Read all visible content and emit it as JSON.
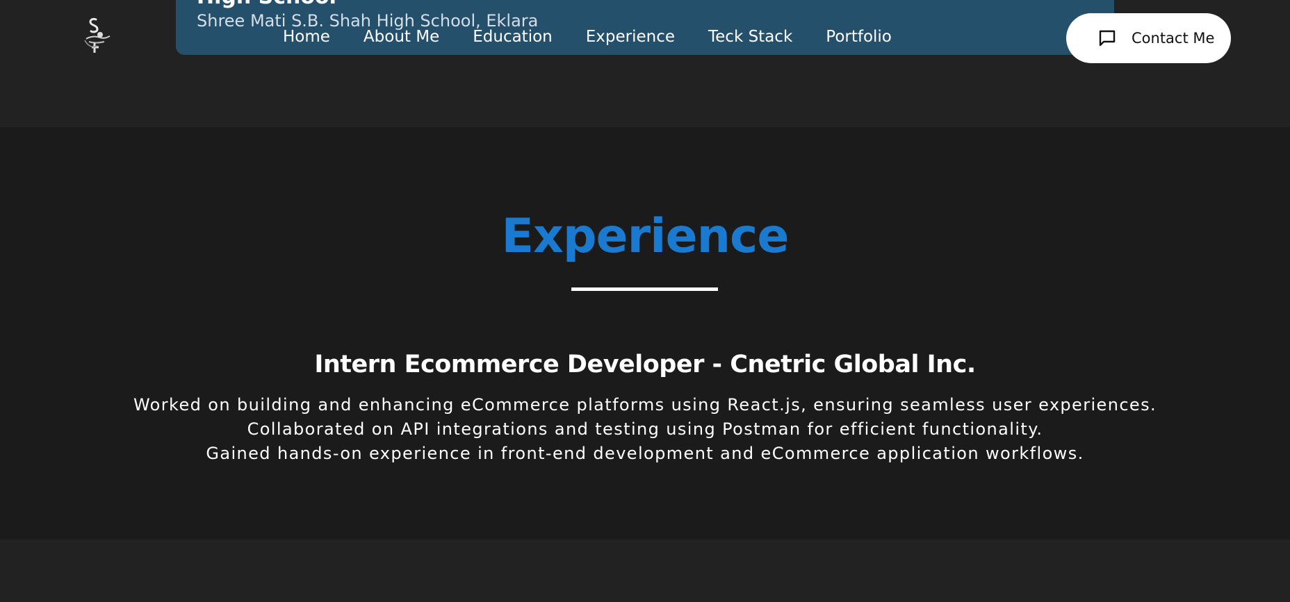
{
  "header": {
    "logo_icon": "swan-logo-icon",
    "education_card": {
      "title": "High School",
      "subtitle": "Shree Mati S.B. Shah High School, Eklara"
    },
    "nav_items": [
      {
        "label": "Home"
      },
      {
        "label": "About Me"
      },
      {
        "label": "Education"
      },
      {
        "label": "Experience"
      },
      {
        "label": "Teck Stack"
      },
      {
        "label": "Portfolio"
      }
    ],
    "contact_button": {
      "label": "Contact Me",
      "icon": "chat-icon"
    }
  },
  "experience": {
    "heading": "Experience",
    "job_title": "Intern Ecommerce Developer - Cnetric Global Inc.",
    "description_lines": [
      "Worked on building and enhancing eCommerce platforms using React.js, ensuring seamless user experiences.",
      "Collaborated on API integrations and testing using Postman for efficient functionality.",
      "Gained hands-on experience in front-end development and eCommerce application workflows."
    ]
  },
  "colors": {
    "accent": "#1a7ad0",
    "card_bg": "#25506b",
    "page_bg": "#222222",
    "section_bg": "#1b1b1b"
  }
}
